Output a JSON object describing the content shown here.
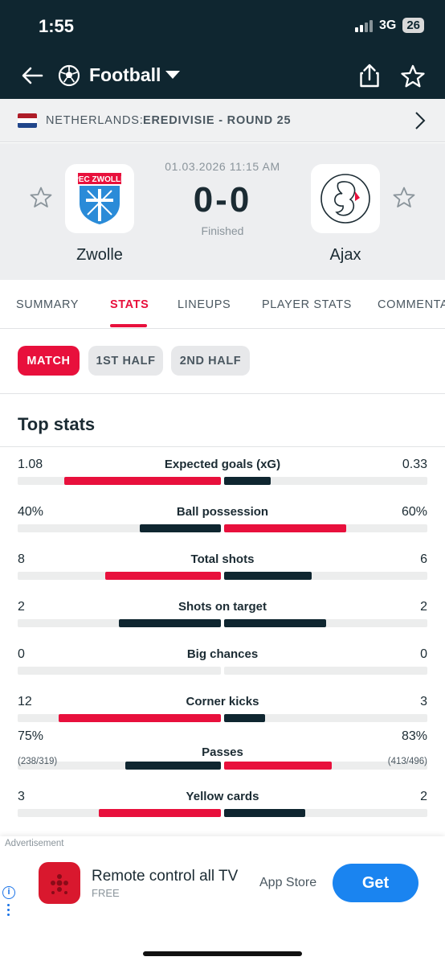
{
  "status_bar": {
    "time": "1:55",
    "network": "3G",
    "battery": "26"
  },
  "header": {
    "sport": "Football",
    "icons": [
      "back-arrow-icon",
      "football-icon",
      "dropdown-caret-icon",
      "share-icon",
      "star-icon"
    ]
  },
  "league": {
    "country": "NETHERLANDS:",
    "name": "EREDIVISIE - ROUND 25",
    "flag_colors": [
      "#ae1c28",
      "#ffffff",
      "#21468b"
    ]
  },
  "match": {
    "datetime": "01.03.2026 11:15 AM",
    "score": "0-0",
    "status": "Finished",
    "home": {
      "name": "Zwolle",
      "crest_text": "PEC ZWOLLE"
    },
    "away": {
      "name": "Ajax"
    }
  },
  "tabs": [
    {
      "label": "SUMMARY",
      "active": false
    },
    {
      "label": "STATS",
      "active": true
    },
    {
      "label": "LINEUPS",
      "active": false
    },
    {
      "label": "PLAYER STATS",
      "active": false
    },
    {
      "label": "COMMENTARY",
      "active": false
    }
  ],
  "periods": [
    {
      "label": "MATCH",
      "active": true
    },
    {
      "label": "1ST HALF",
      "active": false
    },
    {
      "label": "2ND HALF",
      "active": false
    }
  ],
  "section_title": "Top stats",
  "stats": [
    {
      "label": "Expected goals (xG)",
      "home": "1.08",
      "away": "0.33",
      "home_sub": "",
      "away_sub": "",
      "home_share": 0.77,
      "away_share": 0.23,
      "home_color": "#e8103c",
      "away_color": "#0f2630"
    },
    {
      "label": "Ball possession",
      "home": "40%",
      "away": "60%",
      "home_sub": "",
      "away_sub": "",
      "home_share": 0.4,
      "away_share": 0.6,
      "home_color": "#0f2630",
      "away_color": "#e8103c"
    },
    {
      "label": "Total shots",
      "home": "8",
      "away": "6",
      "home_sub": "",
      "away_sub": "",
      "home_share": 0.57,
      "away_share": 0.43,
      "home_color": "#e8103c",
      "away_color": "#0f2630"
    },
    {
      "label": "Shots on target",
      "home": "2",
      "away": "2",
      "home_sub": "",
      "away_sub": "",
      "home_share": 0.5,
      "away_share": 0.5,
      "home_color": "#0f2630",
      "away_color": "#0f2630"
    },
    {
      "label": "Big chances",
      "home": "0",
      "away": "0",
      "home_sub": "",
      "away_sub": "",
      "home_share": 0,
      "away_share": 0,
      "home_color": "#0f2630",
      "away_color": "#0f2630"
    },
    {
      "label": "Corner kicks",
      "home": "12",
      "away": "3",
      "home_sub": "",
      "away_sub": "",
      "home_share": 0.8,
      "away_share": 0.2,
      "home_color": "#e8103c",
      "away_color": "#0f2630"
    },
    {
      "label": "Passes",
      "home": "75%",
      "away": "83%",
      "home_sub": "(238/319)",
      "away_sub": "(413/496)",
      "home_share": 0.47,
      "away_share": 0.53,
      "home_color": "#0f2630",
      "away_color": "#e8103c"
    },
    {
      "label": "Yellow cards",
      "home": "3",
      "away": "2",
      "home_sub": "",
      "away_sub": "",
      "home_share": 0.6,
      "away_share": 0.4,
      "home_color": "#e8103c",
      "away_color": "#0f2630"
    }
  ],
  "ad": {
    "label": "Advertisement",
    "title": "Remote control all TV",
    "subtitle": "FREE",
    "store": "App Store",
    "cta": "Get"
  }
}
